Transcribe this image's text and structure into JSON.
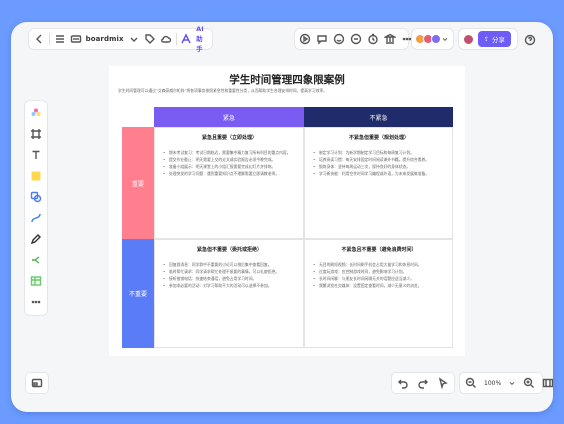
{
  "topbar": {
    "brand": "boardmix",
    "ai_label": "AI助手",
    "share_label": "分享"
  },
  "doc": {
    "title": "学生时间管理四象限案例",
    "intro": "学生时间管理可以通过“艾森豪威尔矩阵”将各项事务按照紧急性和重要性分类，从而帮助学生合理安排时间，提高学习效率。"
  },
  "matrix": {
    "col_urgent": "紧急",
    "col_not_urgent": "不紧急",
    "row_important": "重要",
    "row_not_important": "不重要",
    "q1": {
      "title": "紧急且重要（立即处理）",
      "items": [
        "期末考试复习：考试日期临近，需要集中精力复习所有科目的重点内容。",
        "提交作业截止：明天需要上交的论文或实验报告必须今晚完成。",
        "准备小组展示：明天课堂上的小组汇报需要完成幻灯片并排练。",
        "处理突发的学习问题：遇到重要知识点不理解需要立即请教老师。"
      ]
    },
    "q2": {
      "title": "不紧急但重要（规划处理）",
      "items": [
        "制定学习计划：为新学期制定学习目标和每周复习计划。",
        "培养阅读习惯：每天安排固定时间阅读课外书籍，提升综合素养。",
        "锻炼身体：坚持每周运动三次，保持良好的身体状态。",
        "学习新技能：利用空余时间学习编程或外语，为未来发展做准备。"
      ]
    },
    "q3": {
      "title": "紧急但不重要（委托或拒绝）",
      "items": [
        "回复群消息：同学群中不重要的讨论可以稍后集中查看回复。",
        "临时帮忙请求：同学请求帮忙处理不紧要的事情，可以礼貌拒绝。",
        "接听推销电话：快速结束通话，避免占用学习时间。",
        "参加非必要的活动：对学习帮助不大的活动可以选择不参加。"
      ]
    },
    "q4": {
      "title": "不紧急且不重要（避免浪费时间）",
      "items": [
        "无目的刷短视频：长时间刷手机会占用大量学习和休息时间。",
        "过度玩游戏：应控制游戏时间，避免影响学习计划。",
        "长时间闲聊：与朋友长时间闲聊无关的话题应适当减少。",
        "频繁浏览社交媒体：设置固定查看时间，减少无意义的浏览。"
      ]
    }
  },
  "bottom": {
    "zoom": "100%"
  },
  "colors": {
    "purple": "#7b5cf2",
    "navy": "#1f2b6b",
    "pink": "#ff7f8e",
    "blue": "#5b7cf7"
  }
}
